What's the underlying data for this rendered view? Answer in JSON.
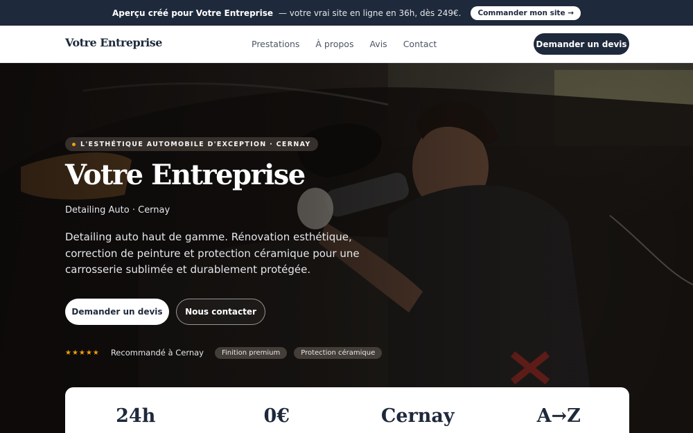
{
  "announcement": {
    "strong": "Aperçu créé pour Votre Entreprise",
    "rest": "— votre vrai site en ligne en 36h, dès 249€.",
    "cta": "Commander mon site →"
  },
  "header": {
    "brand": "Votre Entreprise",
    "nav": [
      "Prestations",
      "À propos",
      "Avis",
      "Contact"
    ],
    "cta": "Demander un devis"
  },
  "hero": {
    "tagline": "L'ESTHÉTIQUE AUTOMOBILE D'EXCEPTION · CERNAY",
    "title": "Votre Entreprise",
    "subtitle": "Detailing Auto · Cernay",
    "description": "Detailing auto haut de gamme. Rénovation esthétique, correction de peinture et protection céramique pour une carrosserie sublimée et durablement protégée.",
    "primary_button": "Demander un devis",
    "secondary_button": "Nous contacter",
    "rating_stars": "★★★★★",
    "recommendation": "Recommandé à Cernay",
    "badges": [
      "Finition premium",
      "Protection céramique"
    ],
    "accent_color": "#f59e0b"
  },
  "stats": [
    "24h",
    "0€",
    "Cernay",
    "A→Z"
  ]
}
